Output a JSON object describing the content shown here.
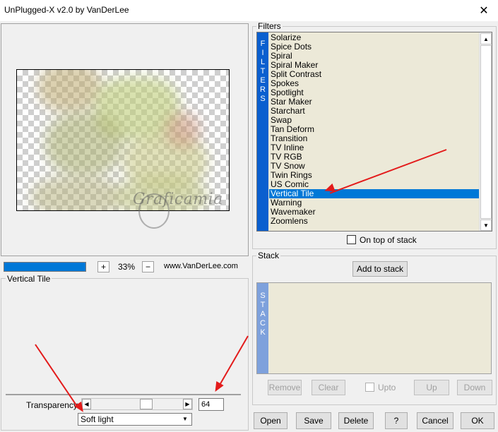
{
  "window": {
    "title": "UnPlugged-X v2.0 by VanDerLee",
    "close_glyph": "✕"
  },
  "preview": {
    "watermark_text": "Graficamia",
    "zoom_minus": "−",
    "zoom_plus": "+",
    "zoom_level": "33%",
    "website": "www.VanDerLee.com",
    "progress_fraction": 1.0
  },
  "filters": {
    "group_label": "Filters",
    "bar_letters": [
      "F",
      "I",
      "L",
      "T",
      "E",
      "R",
      "S"
    ],
    "items": [
      "Solarize",
      "Spice Dots",
      "Spiral",
      "Spiral Maker",
      "Split Contrast",
      "Spokes",
      "Spotlight",
      "Star Maker",
      "Starchart",
      "Swap",
      "Tan Deform",
      "Transition",
      "TV Inline",
      "TV RGB",
      "TV Snow",
      "Twin Rings",
      "US Comic",
      "Vertical Tile",
      "Warning",
      "Wavemaker",
      "Zoomlens"
    ],
    "selected_index": 17,
    "on_top_label": "On top of stack",
    "on_top_checked": false
  },
  "stack": {
    "group_label": "Stack",
    "add_button": "Add to stack",
    "bar_letters": [
      "S",
      "T",
      "A",
      "C",
      "K"
    ],
    "remove_button": "Remove",
    "clear_button": "Clear",
    "upto_label": "Upto",
    "up_button": "Up",
    "down_button": "Down"
  },
  "settings": {
    "group_label": "Vertical Tile",
    "transparency_label": "Transparency",
    "transparency_value": "64",
    "blend_mode": "Soft light"
  },
  "footer": {
    "open_button": "Open",
    "save_button": "Save",
    "delete_button": "Delete",
    "help_button": "?",
    "cancel_button": "Cancel",
    "ok_button": "OK"
  },
  "colors": {
    "accent": "#0078d7",
    "filter_bar": "#0a5fcf",
    "stack_bar": "#7ea1dc",
    "list_bg": "#ece9d8",
    "annotation": "#e31b1b"
  }
}
